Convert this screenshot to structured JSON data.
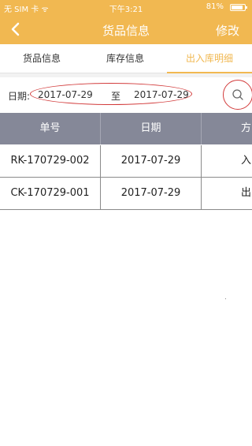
{
  "status_bar": {
    "carrier": "无 SIM 卡 ᯤ",
    "time": "下午3:21",
    "battery": "81%"
  },
  "nav": {
    "title": "货品信息",
    "edit": "修改",
    "back_icon": "chevron-left-icon"
  },
  "tabs": [
    {
      "label": "货品信息"
    },
    {
      "label": "库存信息"
    },
    {
      "label": "出入库明细",
      "active": true
    }
  ],
  "filter": {
    "date_label": "日期:",
    "start_date": "2017-07-29",
    "separator": "至",
    "end_date": "2017-07-29",
    "search_icon": "search-icon"
  },
  "table": {
    "headers": [
      "单号",
      "日期",
      "方"
    ],
    "rows": [
      [
        "RK-170729-002",
        "2017-07-29",
        "入"
      ],
      [
        "CK-170729-001",
        "2017-07-29",
        "出"
      ]
    ]
  },
  "colors": {
    "accent": "#f1b851",
    "header_bg": "#858898",
    "annotation": "#d23b3b"
  }
}
